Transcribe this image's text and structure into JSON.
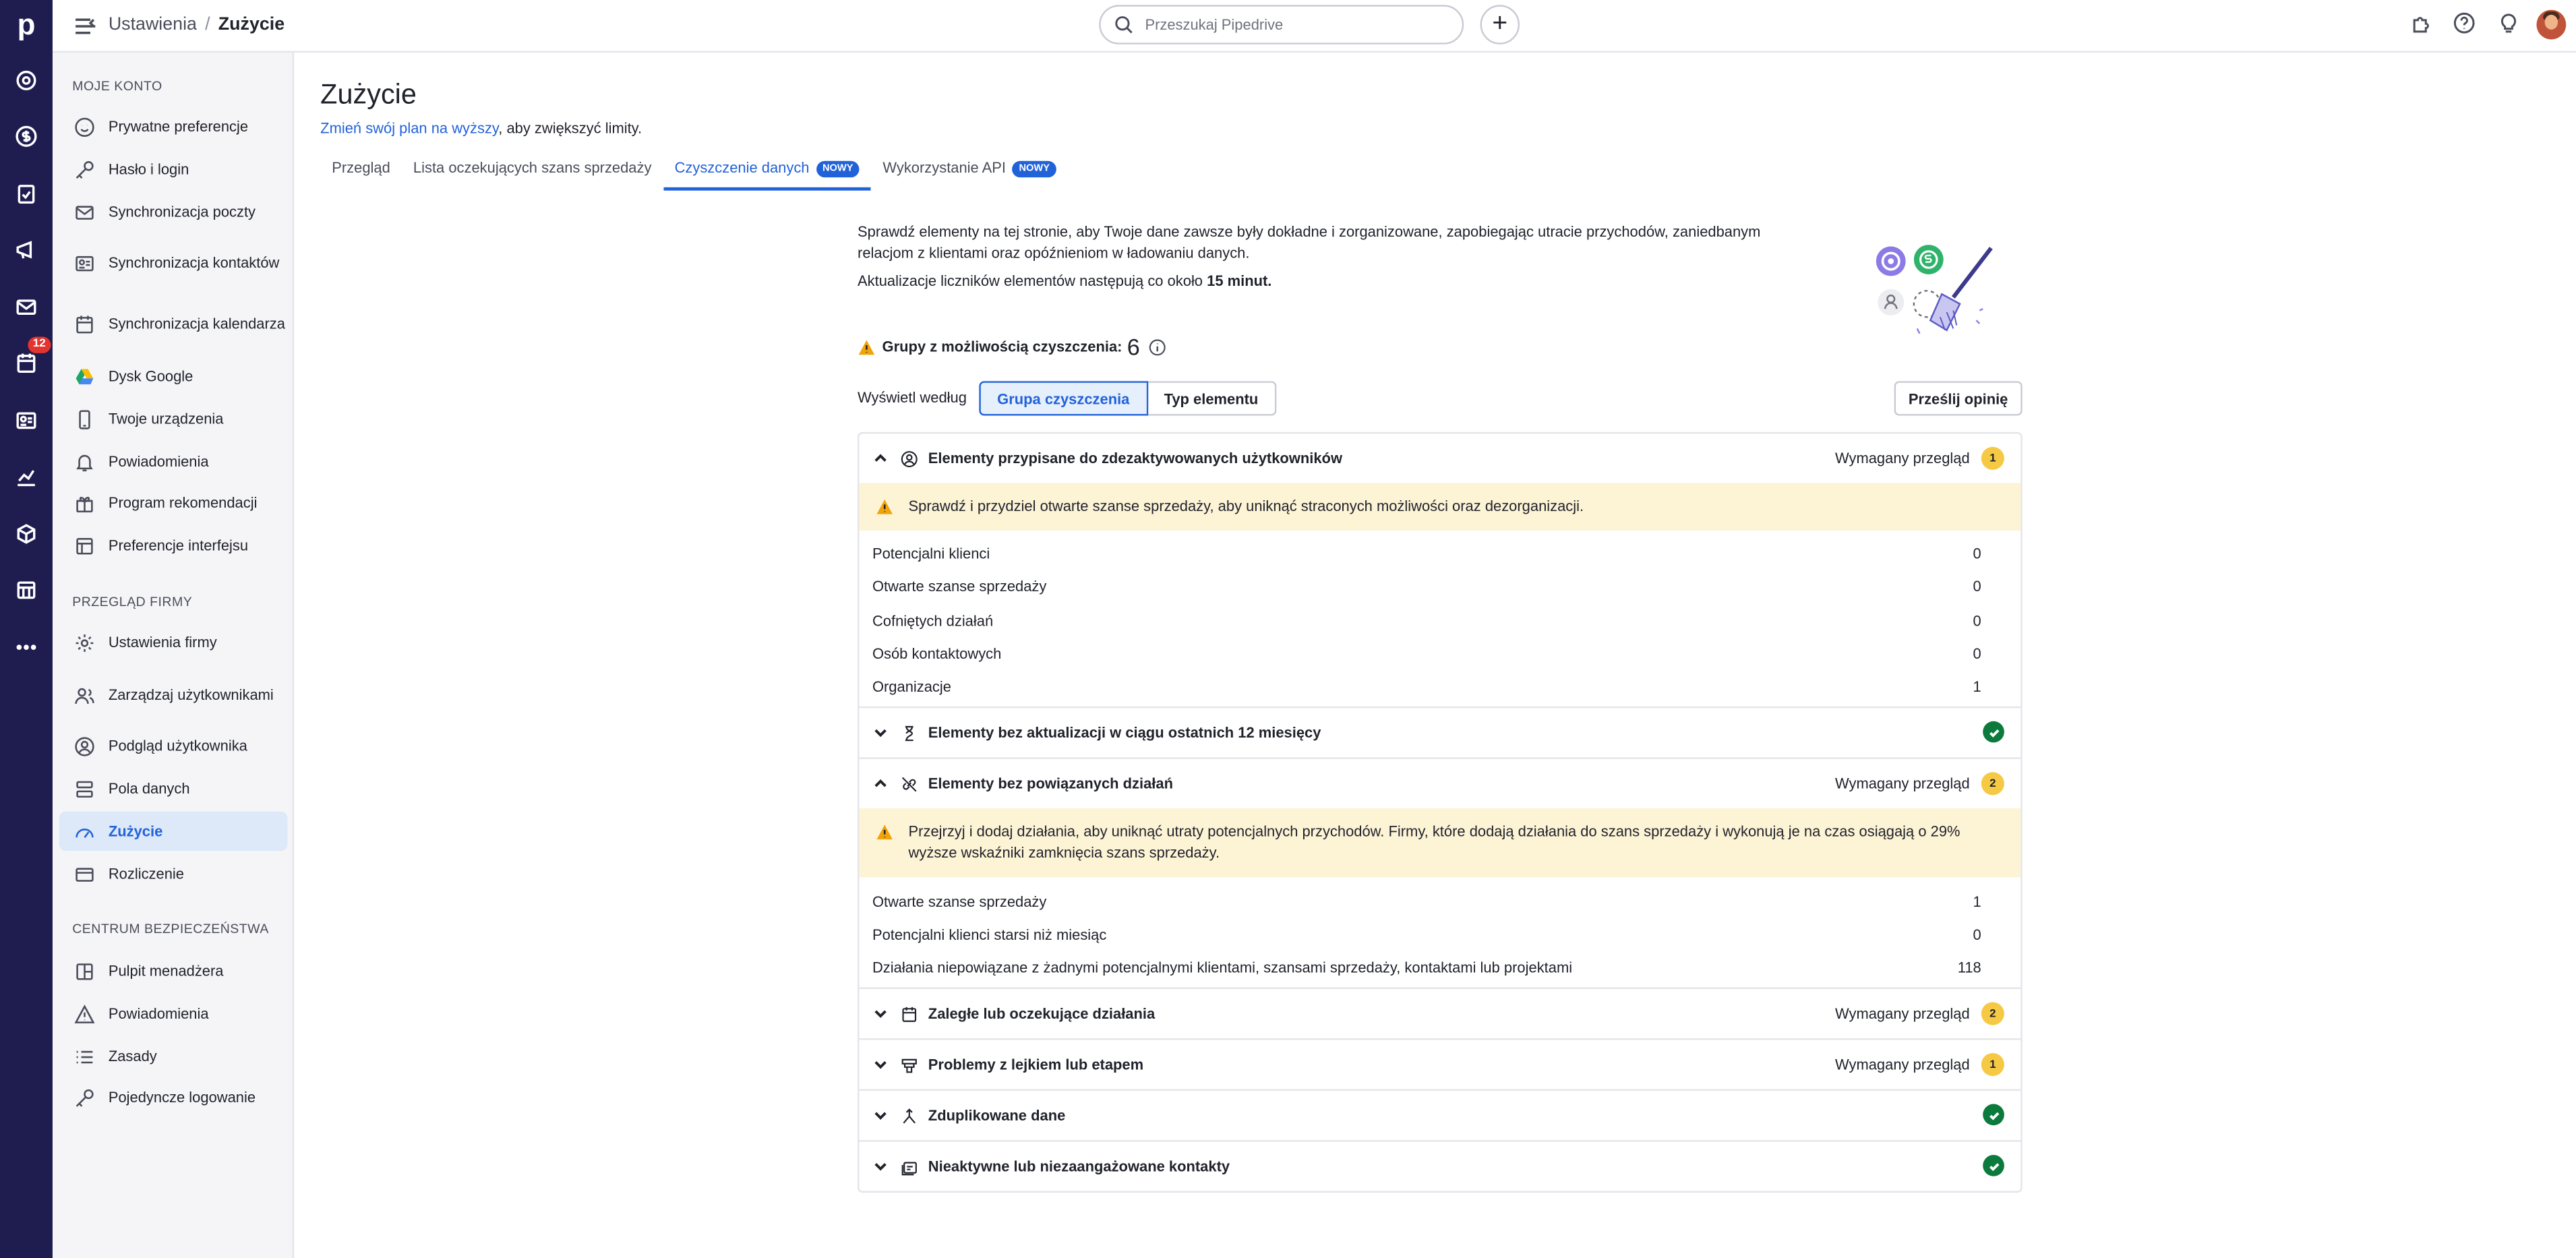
{
  "topbar": {
    "breadcrumb_parent": "Ustawienia",
    "breadcrumb_separator": "/",
    "breadcrumb_current": "Zużycie",
    "search_placeholder": "Przeszukaj Pipedrive",
    "add_label": "+"
  },
  "rail": {
    "logo": "p",
    "activities_badge": "12"
  },
  "sidebar": {
    "section_account": "MOJE KONTO",
    "account_items": [
      {
        "label": "Prywatne preferencje",
        "icon": "smiley-icon"
      },
      {
        "label": "Hasło i login",
        "icon": "key-icon"
      },
      {
        "label": "Synchronizacja poczty",
        "icon": "mail-icon"
      },
      {
        "label": "Synchronizacja kontaktów",
        "icon": "contact-card-icon"
      },
      {
        "label": "Synchronizacja kalendarza",
        "icon": "calendar-icon"
      },
      {
        "label": "Dysk Google",
        "icon": "google-drive-icon"
      },
      {
        "label": "Twoje urządzenia",
        "icon": "phone-icon"
      },
      {
        "label": "Powiadomienia",
        "icon": "bell-icon"
      },
      {
        "label": "Program rekomendacji",
        "icon": "gift-icon"
      },
      {
        "label": "Preferencje interfejsu",
        "icon": "layout-icon"
      }
    ],
    "section_company": "PRZEGLĄD FIRMY",
    "company_items": [
      {
        "label": "Ustawienia firmy",
        "icon": "gear-icon"
      },
      {
        "label": "Zarządzaj użytkownikami",
        "icon": "users-icon"
      },
      {
        "label": "Podgląd użytkownika",
        "icon": "user-circle-icon"
      },
      {
        "label": "Pola danych",
        "icon": "fields-icon"
      },
      {
        "label": "Zużycie",
        "icon": "gauge-icon"
      },
      {
        "label": "Rozliczenie",
        "icon": "credit-card-icon"
      }
    ],
    "section_security": "CENTRUM BEZPIECZEŃSTWA",
    "security_items": [
      {
        "label": "Pulpit menadżera",
        "icon": "dashboard-icon"
      },
      {
        "label": "Powiadomienia",
        "icon": "warning-icon"
      },
      {
        "label": "Zasady",
        "icon": "list-icon"
      },
      {
        "label": "Pojedyncze logowanie",
        "icon": "key-icon"
      }
    ]
  },
  "main": {
    "title": "Zużycie",
    "upgrade_link": "Zmień swój plan na wyższy",
    "upgrade_rest": ", aby zwiększyć limity.",
    "tabs": [
      {
        "label": "Przegląd",
        "badge": ""
      },
      {
        "label": "Lista oczekujących szans sprzedaży",
        "badge": ""
      },
      {
        "label": "Czyszczenie danych",
        "badge": "NOWY"
      },
      {
        "label": "Wykorzystanie API",
        "badge": "NOWY"
      }
    ],
    "intro": "Sprawdź elementy na tej stronie, aby Twoje dane zawsze były dokładne i zorganizowane, zapobiegając utracie przychodów, zaniedbanym relacjom z klientami oraz opóźnieniom w ładowaniu danych.",
    "update_prefix": "Aktualizacje liczników elementów następują co około ",
    "update_value": "15 minut.",
    "groups_label": "Grupy z możliwością czyszczenia:",
    "groups_count": "6",
    "view_by_label": "Wyświetl według",
    "view_options": [
      "Grupa czyszczenia",
      "Typ elementu"
    ],
    "feedback_button": "Prześlij opinię",
    "review_label": "Wymagany przegląd",
    "groups": [
      {
        "title": "Elementy przypisane do zdezaktywowanych użytkowników",
        "icon": "user-circle-icon",
        "expanded": true,
        "status": "review",
        "count": "1",
        "alert": "Sprawdź i przydziel otwarte szanse sprzedaży, aby uniknąć straconych możliwości oraz dezorganizacji.",
        "rows": [
          {
            "label": "Potencjalni klienci",
            "value": "0"
          },
          {
            "label": "Otwarte szanse sprzedaży",
            "value": "0"
          },
          {
            "label": "Cofniętych działań",
            "value": "0"
          },
          {
            "label": "Osób kontaktowych",
            "value": "0"
          },
          {
            "label": "Organizacje",
            "value": "1"
          }
        ]
      },
      {
        "title": "Elementy bez aktualizacji w ciągu ostatnich 12 miesięcy",
        "icon": "hourglass-icon",
        "expanded": false,
        "status": "ok"
      },
      {
        "title": "Elementy bez powiązanych działań",
        "icon": "unlink-icon",
        "expanded": true,
        "status": "review",
        "count": "2",
        "alert": "Przejrzyj i dodaj działania, aby uniknąć utraty potencjalnych przychodów. Firmy, które dodają działania do szans sprzedaży i wykonują je na czas osiągają o 29% wyższe wskaźniki zamknięcia szans sprzedaży.",
        "rows": [
          {
            "label": "Otwarte szanse sprzedaży",
            "value": "1"
          },
          {
            "label": "Potencjalni klienci starsi niż miesiąc",
            "value": "0"
          },
          {
            "label": "Działania niepowiązane z żadnymi potencjalnymi klientami, szansami sprzedaży, kontaktami lub projektami",
            "value": "118"
          }
        ]
      },
      {
        "title": "Zaległe lub oczekujące działania",
        "icon": "calendar-icon",
        "expanded": false,
        "status": "review",
        "count": "2"
      },
      {
        "title": "Problemy z lejkiem lub etapem",
        "icon": "pipeline-icon",
        "expanded": false,
        "status": "review",
        "count": "1"
      },
      {
        "title": "Zduplikowane dane",
        "icon": "merge-icon",
        "expanded": false,
        "status": "ok"
      },
      {
        "title": "Nieaktywne lub niezaangażowane kontakty",
        "icon": "contacts-icon",
        "expanded": false,
        "status": "ok"
      }
    ]
  },
  "colors": {
    "accent": "#2162d9",
    "rail": "#1f1d4f",
    "warning": "#f6c945",
    "alert_bg": "#fdf3d5",
    "success": "#0b7a3c"
  }
}
